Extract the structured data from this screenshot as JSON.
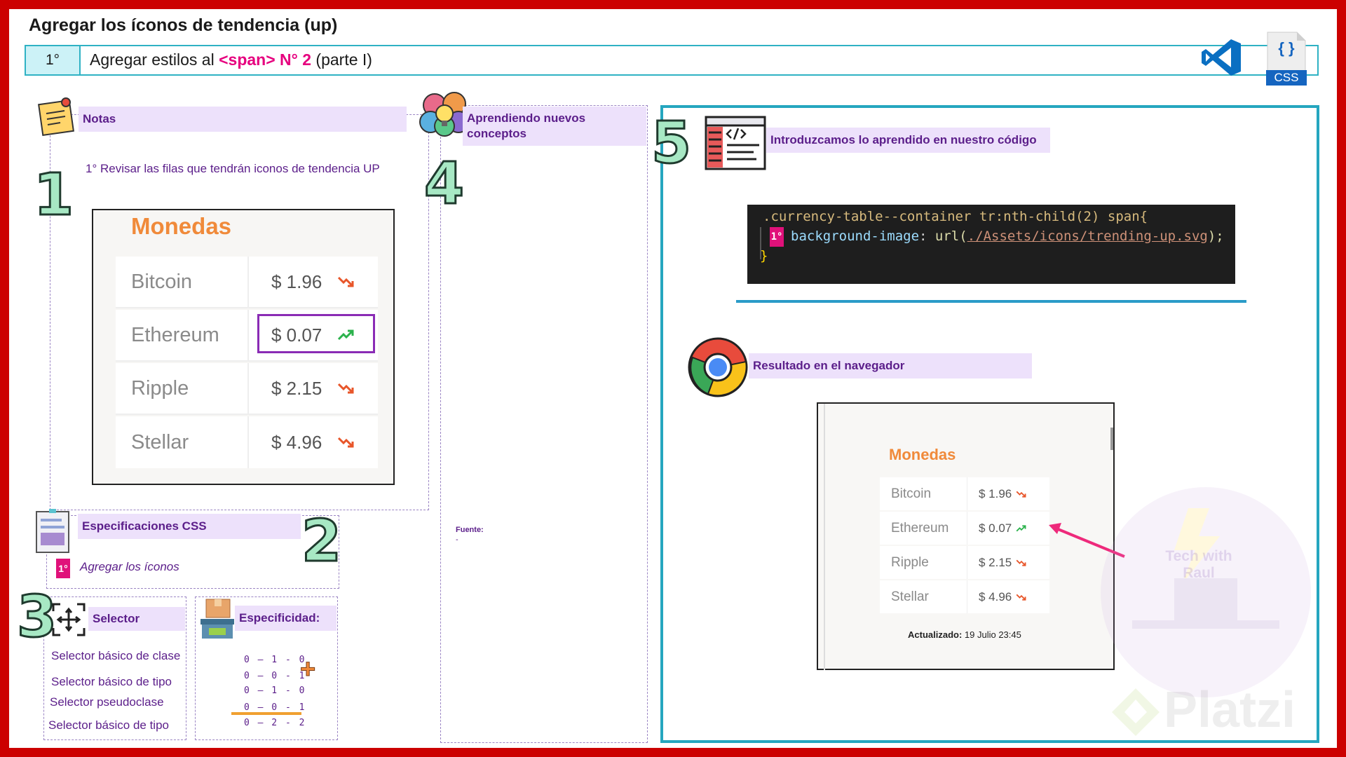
{
  "header": {
    "title": "Agregar los íconos de tendencia (up)",
    "step_number": "1°",
    "step_text_before": "Agregar estilos al ",
    "step_text_highlight": "<span> N° 2",
    "step_text_after": " (parte I)",
    "css_icon_label": "CSS",
    "css_icon_braces": "{ }"
  },
  "notes": {
    "header": "Notas",
    "number": "1",
    "text": "1° Revisar las filas que tendrán iconos de tendencia UP",
    "table": {
      "title": "Monedas",
      "rows": [
        {
          "name": "Bitcoin",
          "price": "$ 1.96",
          "trend": "down"
        },
        {
          "name": "Ethereum",
          "price": "$ 0.07",
          "trend": "up"
        },
        {
          "name": "Ripple",
          "price": "$ 2.15",
          "trend": "down"
        },
        {
          "name": "Stellar",
          "price": "$ 4.96",
          "trend": "down"
        }
      ]
    }
  },
  "specs": {
    "header": "Especificaciones CSS",
    "number": "2",
    "badge": "1°",
    "text": "Agregar los íconos"
  },
  "selector": {
    "number": "3",
    "header": "Selector",
    "items": [
      "Selector básico de clase",
      "Selector básico de tipo",
      "Selector pseudoclase",
      "Selector básico de tipo"
    ]
  },
  "specificity": {
    "header": "Especificidad:",
    "lines": [
      "0 – 1 - 0",
      "0 – 0 - 1",
      "0 – 1 - 0",
      "0 – 0 - 1"
    ],
    "total": "0 – 2 - 2",
    "plus": "+"
  },
  "concepts": {
    "header": "Aprendiendo nuevos conceptos",
    "number": "4",
    "source_label": "Fuente:",
    "source_value": "-"
  },
  "code_section": {
    "number": "5",
    "header": "Introduzcamos lo aprendido en nuestro código",
    "line1": ".currency-table--container tr:nth-child(2) span{",
    "badge": "1°",
    "line2_prop": "background-image",
    "line2_func": "url(",
    "line2_url": "./Assets/icons/trending-up.svg",
    "line2_end": ");",
    "line3": "}"
  },
  "browser": {
    "header": "Resultado en el navegador",
    "table": {
      "title": "Monedas",
      "rows": [
        {
          "name": "Bitcoin",
          "price": "$ 1.96",
          "trend": "down"
        },
        {
          "name": "Ethereum",
          "price": "$ 0.07",
          "trend": "up"
        },
        {
          "name": "Ripple",
          "price": "$ 2.15",
          "trend": "down"
        },
        {
          "name": "Stellar",
          "price": "$ 4.96",
          "trend": "down"
        }
      ],
      "updated_label": "Actualizado:",
      "updated_value": " 19 Julio 23:45"
    }
  },
  "watermark": {
    "brand": "Platzi",
    "logo_text": "Tech with Raul"
  },
  "colors": {
    "frame": "#cc0000",
    "accent_teal": "#2fb2c4",
    "accent_purple": "#5b1e8a",
    "accent_pink": "#e6007e",
    "trend_up": "#2bb24c",
    "trend_down": "#e8562a",
    "monedas_orange": "#f08a3a"
  }
}
